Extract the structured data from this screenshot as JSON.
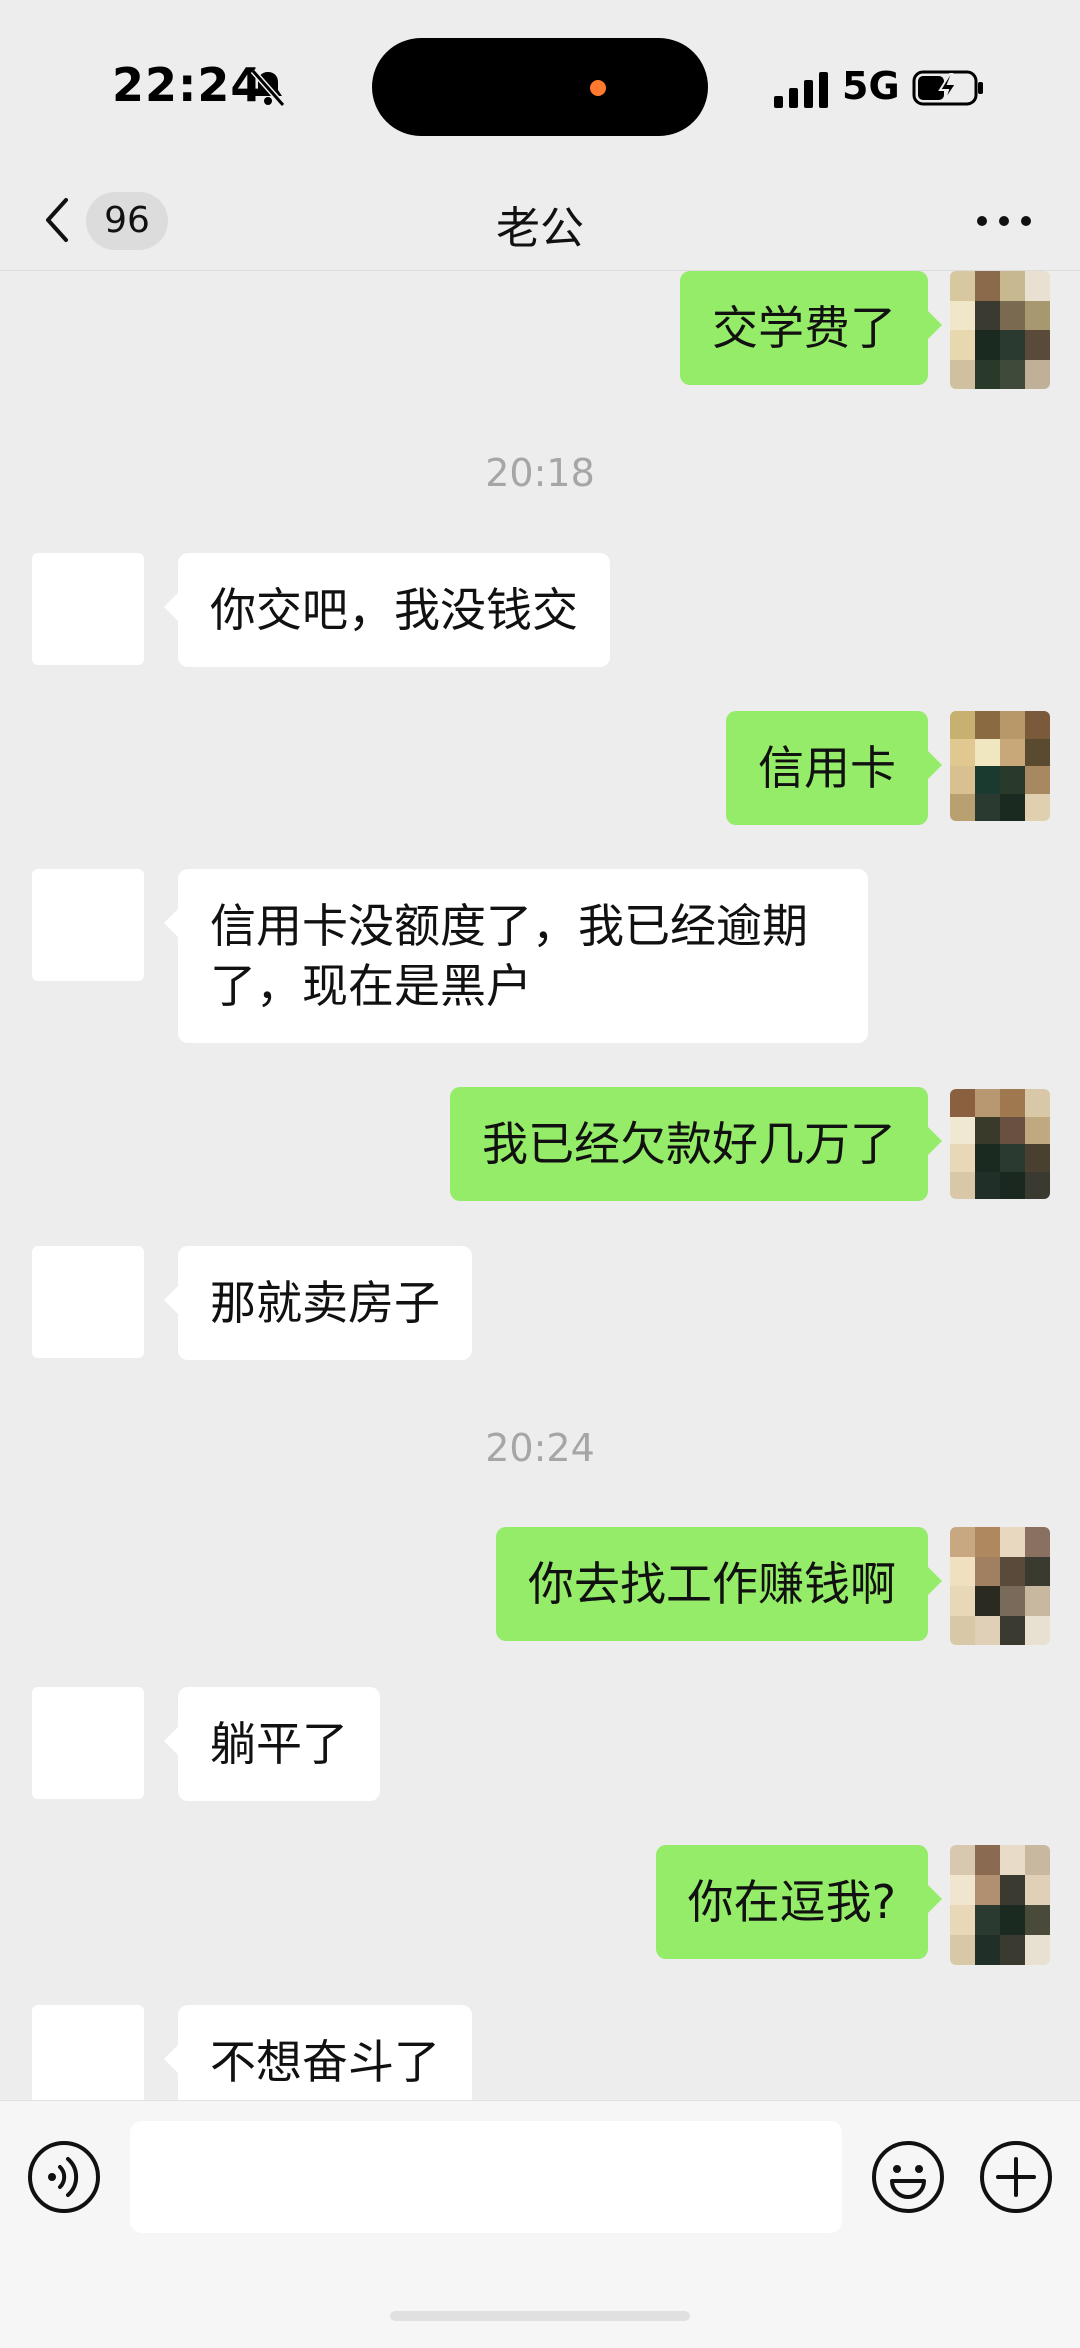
{
  "status_bar": {
    "time": "22:24",
    "network": "5G",
    "icons": [
      "bell-off-icon",
      "signal-icon",
      "battery-charging-icon"
    ]
  },
  "nav": {
    "unread_count": "96",
    "title": "老公",
    "icons": [
      "chevron-left-icon",
      "more-icon"
    ]
  },
  "messages": [
    {
      "side": "right",
      "text": "交学费了"
    },
    {
      "type": "timestamp",
      "text": "20:18"
    },
    {
      "side": "left",
      "text": "你交吧，我没钱交"
    },
    {
      "side": "right",
      "text": "信用卡"
    },
    {
      "side": "left",
      "lines": [
        "信用卡没额度了，我已经逾期",
        "了，现在是黑户"
      ]
    },
    {
      "side": "right",
      "text": "我已经欠款好几万了"
    },
    {
      "side": "left",
      "text": "那就卖房子"
    },
    {
      "type": "timestamp",
      "text": "20:24"
    },
    {
      "side": "right",
      "text": "你去找工作赚钱啊"
    },
    {
      "side": "left",
      "text": "躺平了"
    },
    {
      "side": "right",
      "text": "你在逗我?"
    },
    {
      "side": "left",
      "text": "不想奋斗了"
    }
  ],
  "input_bar": {
    "placeholder": "",
    "icons": [
      "voice-icon",
      "emoji-icon",
      "plus-icon"
    ]
  },
  "colors": {
    "background": "#ededed",
    "bubble_self": "#95ec69",
    "bubble_other": "#ffffff",
    "timestamp": "#a6a6a6"
  }
}
